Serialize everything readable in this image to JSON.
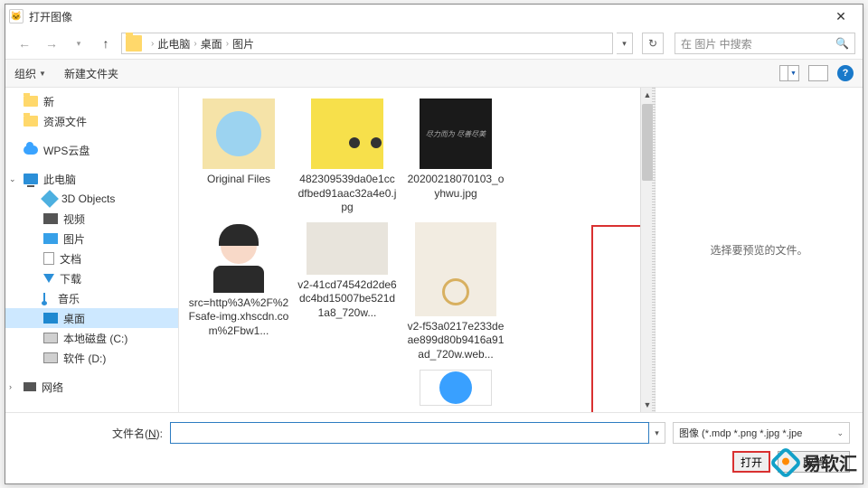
{
  "window": {
    "title": "打开图像",
    "close": "✕"
  },
  "nav": {
    "crumbs": [
      "此电脑",
      "桌面",
      "图片"
    ],
    "search_placeholder": "在 图片 中搜索"
  },
  "toolbar": {
    "organize": "组织",
    "newfolder": "新建文件夹"
  },
  "tree": {
    "quick": [
      {
        "label": "新"
      },
      {
        "label": "资源文件"
      }
    ],
    "cloud": "WPS云盘",
    "pc": "此电脑",
    "pc_children": [
      {
        "label": "3D Objects",
        "ico": "ico-3d"
      },
      {
        "label": "视频",
        "ico": "ico-vid"
      },
      {
        "label": "图片",
        "ico": "ico-img"
      },
      {
        "label": "文档",
        "ico": "ico-doc"
      },
      {
        "label": "下载",
        "ico": "ico-down"
      },
      {
        "label": "音乐",
        "ico": "ico-music"
      },
      {
        "label": "桌面",
        "ico": "ico-desk",
        "selected": true
      },
      {
        "label": "本地磁盘 (C:)",
        "ico": "ico-disk"
      },
      {
        "label": "软件 (D:)",
        "ico": "ico-disk"
      }
    ],
    "network": "网络"
  },
  "files": [
    {
      "name": "Original Files",
      "thumb": "folder"
    },
    {
      "name": "482309539da0e1ccdfbed91aac32a4e0.jpg",
      "thumb": "sp"
    },
    {
      "name": "20200218070103_oyhwu.jpg",
      "thumb": "dark"
    },
    {
      "name": "src=http%3A%2F%2Fsafe-img.xhscdn.com%2Fbw1...",
      "thumb": "portrait"
    },
    {
      "name": "v2-41cd74542d2de6dc4bd15007be521d1a8_720w...",
      "thumb": "wide"
    },
    {
      "name": "v2-f53a0217e233deae899d80b9416a91ad_720w.web...",
      "thumb": "selected-frame"
    }
  ],
  "preview": {
    "empty": "选择要预览的文件。"
  },
  "footer": {
    "filename_label_pre": "文件名(",
    "filename_label_u": "N",
    "filename_label_post": "):",
    "filter": "图像 (*.mdp *.png *.jpg *.jpe",
    "open": "打开",
    "cancel": "取消"
  },
  "watermark": "易软汇"
}
